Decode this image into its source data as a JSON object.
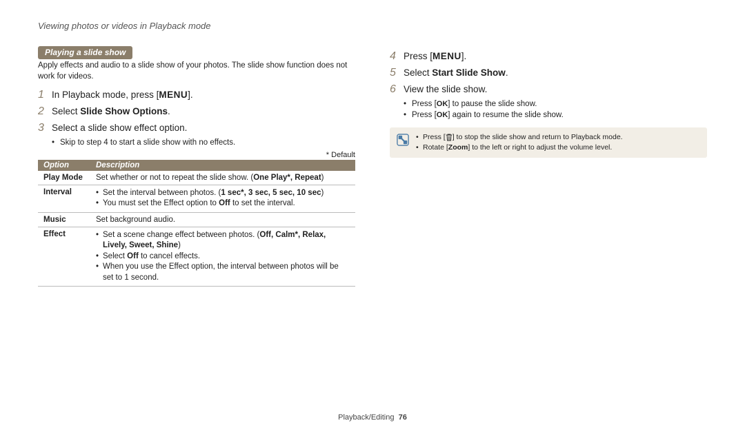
{
  "header": {
    "title": "Viewing photos or videos in Playback mode"
  },
  "left": {
    "section_title": "Playing a slide show",
    "intro": "Apply effects and audio to a slide show of your photos. The slide show function does not work for videos.",
    "step1": {
      "num": "1",
      "pre": "In Playback mode, press [",
      "btn": "MENU",
      "post": "]."
    },
    "step2": {
      "num": "2",
      "pre": "Select ",
      "bold": "Slide Show Options",
      "post": "."
    },
    "step3": {
      "num": "3",
      "text": "Select a slide show effect option."
    },
    "step3_sub": "Skip to step 4 to start a slide show with no effects.",
    "default_label": "* Default",
    "table": {
      "h1": "Option",
      "h2": "Description",
      "rows": {
        "r0": {
          "name": "Play Mode",
          "desc_pre": "Set whether or not to repeat the slide show. (",
          "desc_bold": "One Play*, Repeat",
          "desc_post": ")"
        },
        "r1": {
          "name": "Interval",
          "b1_pre": "Set the interval between photos. (",
          "b1_bold": "1 sec*, 3 sec, 5 sec, 10 sec",
          "b1_post": ")",
          "b2_pre": "You must set the Effect option to ",
          "b2_bold": "Off",
          "b2_post": " to set the interval."
        },
        "r2": {
          "name": "Music",
          "desc": "Set background audio."
        },
        "r3": {
          "name": "Effect",
          "b1_pre": "Set a scene change effect between photos. (",
          "b1_bold": "Off, Calm*, Relax, Lively, Sweet, Shine",
          "b1_post": ")",
          "b2_pre": "Select ",
          "b2_bold": "Off",
          "b2_post": " to cancel effects.",
          "b3": "When you use the Effect option, the interval between photos will be set to 1 second."
        }
      }
    }
  },
  "right": {
    "step4": {
      "num": "4",
      "pre": "Press [",
      "btn": "MENU",
      "post": "]."
    },
    "step5": {
      "num": "5",
      "pre": "Select ",
      "bold": "Start Slide Show",
      "post": "."
    },
    "step6": {
      "num": "6",
      "text": "View the slide show."
    },
    "step6_sub1": {
      "pre": "Press [",
      "btn": "OK",
      "post": "] to pause the slide show."
    },
    "step6_sub2": {
      "pre": "Press [",
      "btn": "OK",
      "post": "] again to resume the slide show."
    },
    "note": {
      "n1_pre": "Press [",
      "n1_post": "] to stop the slide show and return to Playback mode.",
      "n2_pre": "Rotate [",
      "n2_bold": "Zoom",
      "n2_post": "] to the left or right to adjust the volume level."
    }
  },
  "footer": {
    "section": "Playback/Editing",
    "page": "76"
  }
}
